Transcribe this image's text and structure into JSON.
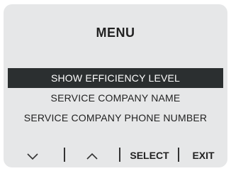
{
  "screen": {
    "title": "MENU"
  },
  "menu": {
    "items": [
      {
        "label": "SHOW EFFICIENCY LEVEL",
        "selected": true
      },
      {
        "label": "SERVICE COMPANY NAME",
        "selected": false
      },
      {
        "label": "SERVICE COMPANY PHONE NUMBER",
        "selected": false
      }
    ]
  },
  "controls": {
    "down_icon": "chevron-down-icon",
    "up_icon": "chevron-up-icon",
    "select_label": "SELECT",
    "exit_label": "EXIT"
  },
  "colors": {
    "background": "#e6e7e8",
    "highlight": "#2b2f30",
    "highlight_text": "#ffffff",
    "text": "#222222"
  }
}
